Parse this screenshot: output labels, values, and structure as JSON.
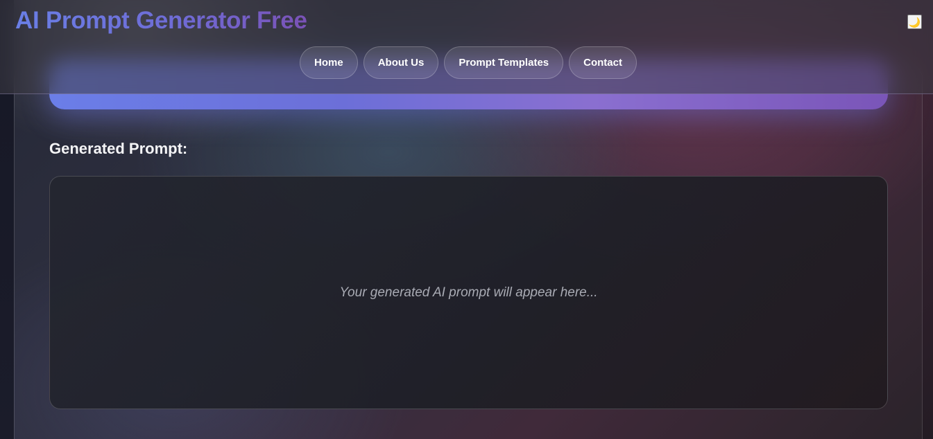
{
  "header": {
    "title": "AI Prompt Generator Free",
    "theme_toggle_icon": "moon-icon",
    "theme_toggle_glyph": "🌙"
  },
  "nav": {
    "items": [
      {
        "label": "Home"
      },
      {
        "label": "About Us"
      },
      {
        "label": "Prompt Templates"
      },
      {
        "label": "Contact"
      }
    ]
  },
  "main": {
    "generate_button_label": "",
    "output_heading": "Generated Prompt:",
    "output_placeholder": "Your generated AI prompt will appear here..."
  },
  "colors": {
    "accent_start": "#6b7ee8",
    "accent_end": "#7a55b8",
    "text_primary": "#ffffff",
    "text_muted": "#a9abb4"
  }
}
